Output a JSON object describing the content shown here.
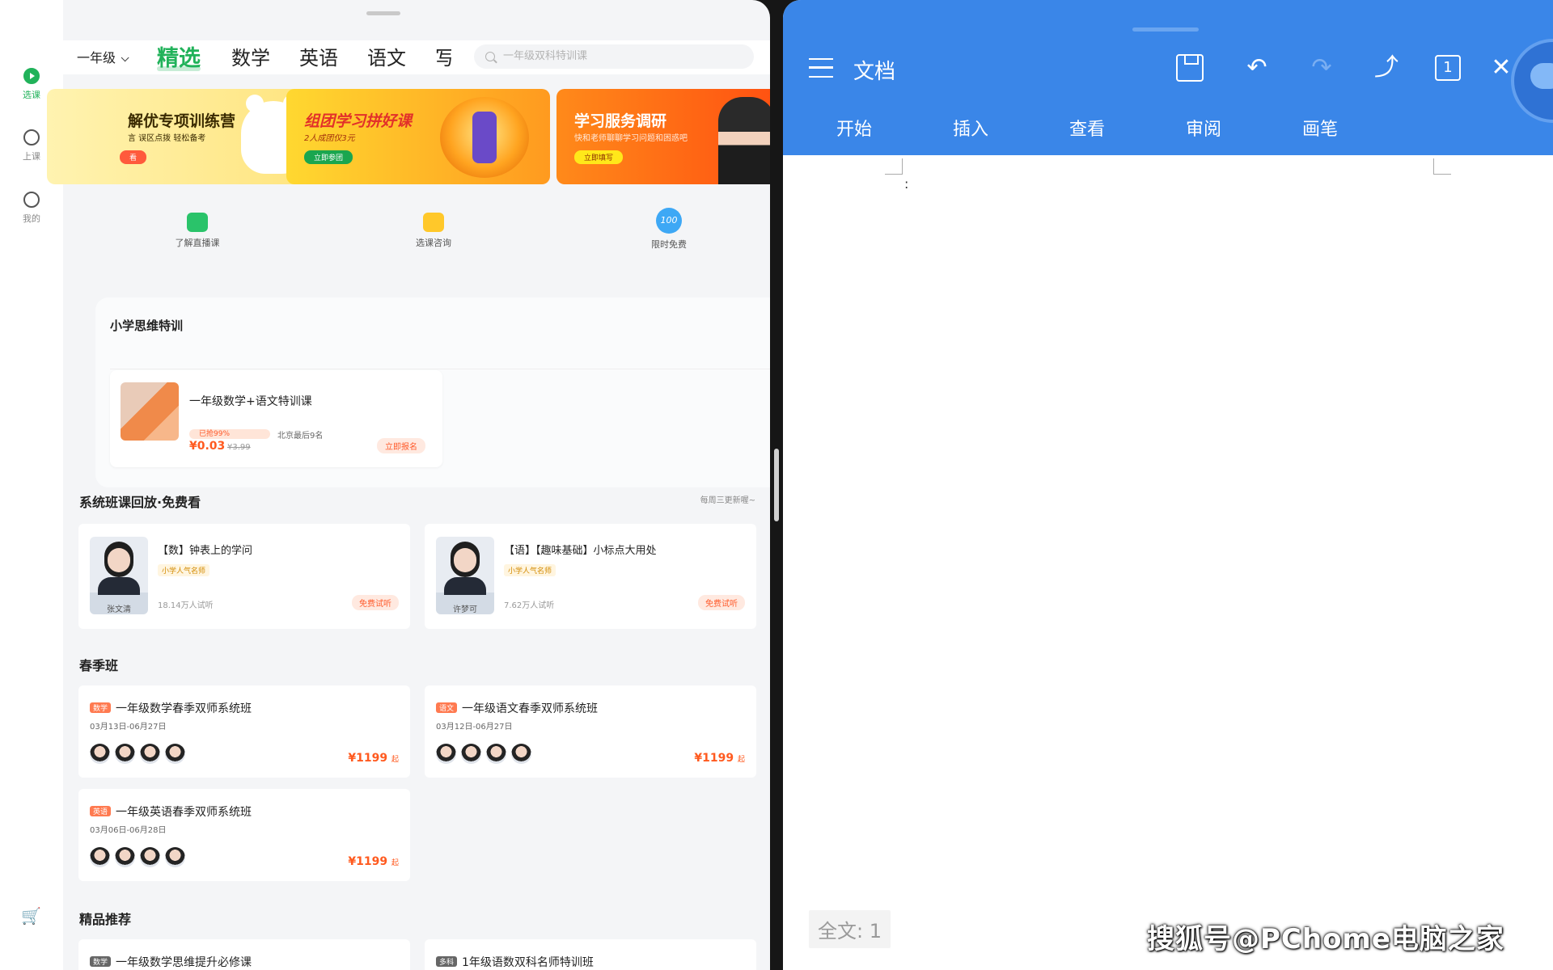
{
  "left_app": {
    "rail": [
      {
        "label": "选课",
        "active": true
      },
      {
        "label": "上课",
        "active": false
      },
      {
        "label": "我的",
        "active": false
      }
    ],
    "grade": "一年级",
    "tabs": [
      "精选",
      "数学",
      "英语",
      "语文",
      "写"
    ],
    "active_tab": "精选",
    "search_placeholder": "一年级双科特训课",
    "banners": [
      {
        "title": "解优专项训练营",
        "sub": "言 误区点拨 轻松备考",
        "button": "看"
      },
      {
        "title": "组团学习拼好课",
        "sub": "2人成团仅3元",
        "button": "立即参团"
      },
      {
        "title": "学习服务调研",
        "sub": "快和老师聊聊学习问题和困惑吧",
        "button": "立即填写"
      }
    ],
    "quick": [
      {
        "label": "了解直播课",
        "icon": "live-icon"
      },
      {
        "label": "选课咨询",
        "icon": "chat-icon"
      },
      {
        "label": "限时免费",
        "icon": "100-icon",
        "icon_text": "100"
      }
    ],
    "special": {
      "title": "小学思维特训",
      "course": {
        "name": "一年级数学+语文特训课",
        "tag": "已抢99%",
        "city": "北京最后9名",
        "price": "¥0.03",
        "orig": "¥3.99",
        "button": "立即报名"
      }
    },
    "replay": {
      "title": "系统班课回放·免费看",
      "more": "每周三更新喔~",
      "items": [
        {
          "title": "【数】钟表上的学问",
          "badge": "小学人气名师",
          "count": "18.14万人试听",
          "btn": "免费试听",
          "teacher": "张文清"
        },
        {
          "title": "【语】【趣味基础】小标点大用处",
          "badge": "小学人气名师",
          "count": "7.62万人试听",
          "btn": "免费试听",
          "teacher": "许梦可"
        }
      ]
    },
    "spring": {
      "title": "春季班",
      "items": [
        {
          "subject": "数学",
          "title": "一年级数学春季双师系统班",
          "date": "03月13日-06月27日",
          "price": "¥1199",
          "suffix": "起"
        },
        {
          "subject": "语文",
          "title": "一年级语文春季双师系统班",
          "date": "03月12日-06月27日",
          "price": "¥1199",
          "suffix": "起"
        },
        {
          "subject": "英语",
          "title": "一年级英语春季双师系统班",
          "date": "03月06日-06月28日",
          "price": "¥1199",
          "suffix": "起"
        }
      ]
    },
    "recommend": {
      "title": "精品推荐",
      "items": [
        {
          "subject": "数学",
          "title": "一年级数学思维提升必修课"
        },
        {
          "subject": "多科",
          "title": "1年级语数双科名师特训班"
        }
      ]
    }
  },
  "right_app": {
    "title": "文档",
    "page_num": "1",
    "tabs": [
      "开始",
      "插入",
      "查看",
      "审阅",
      "画笔"
    ],
    "cursor": ":",
    "word_count": "全文: 1"
  },
  "watermark": "搜狐号@PChome电脑之家",
  "colors": {
    "accent_green": "#21b25a",
    "doc_blue": "#3a86e8",
    "price_orange": "#ff5a1f"
  }
}
